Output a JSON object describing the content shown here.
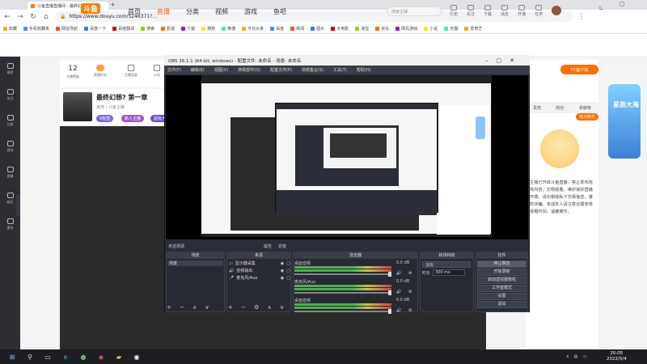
{
  "browser": {
    "tab_title": "斗鱼直播直播间 - 最终幻想?第一章",
    "url": "https://www.douyu.com/5246371?...",
    "bookmarks": [
      "收藏",
      "手机收藏夹",
      "网址导航",
      "百度一下",
      "百度翻译",
      "搜索",
      "影视",
      "下载",
      "搜狗",
      "微博",
      "今日头条",
      "百度",
      "新闻",
      "图片",
      "大电影",
      "淘宝",
      "京东",
      "网页游戏",
      "小说",
      "天猫",
      "爱奇艺"
    ]
  },
  "site": {
    "logo_text": "斗鱼",
    "nav": [
      "首页",
      "直播",
      "分类",
      "视频",
      "游戏",
      "鱼吧"
    ],
    "active_nav": 1,
    "search_placeholder": "搜索主播",
    "header_icons": [
      "历史",
      "关注",
      "下载",
      "消息",
      "开播",
      "任务"
    ],
    "sidebar": [
      "推荐",
      "关注",
      "分类",
      "游戏",
      "直播",
      "娱乐",
      "更多"
    ]
  },
  "room": {
    "followers": "12",
    "stat_labels": [
      "主播等级",
      "直播时长",
      "主播奖励",
      "公告",
      "贡献"
    ],
    "title": "最终幻想? 第一章",
    "subtitle": "其他 | 斗鱼主播",
    "tags": [
      "V标签",
      "新人主播",
      "超级大神"
    ],
    "pc_client": "PC客户端",
    "fan_club": "成为粉丝",
    "right_tabs": [
      "贵宾",
      "粉丝",
      "贡献榜"
    ],
    "promo_text": "星辰大海",
    "rules_text": "主播已开启斗鱼直播，禁止发布违规内容，文明观看，维护良好直播环境。请勿相信私下交易信息，谨防诈骗，未成年人请注意合理安排观看时间，适度娱乐。"
  },
  "obs": {
    "title": "OBS 26.1.1 (64-bit, windows) - 配置文件: 未命名 - 场景: 未命名",
    "menu": [
      "文件(F)",
      "编辑(E)",
      "视图(V)",
      "停靠部件(D)",
      "配置文件(P)",
      "场景集合(S)",
      "工具(T)",
      "帮助(H)"
    ],
    "scene_bar_label": "未选择源",
    "scene_bar_props": "属性",
    "scene_bar_filters": "滤镜",
    "docks": {
      "scenes": {
        "title": "场景",
        "items": [
          "场景"
        ]
      },
      "sources": {
        "title": "来源",
        "items": [
          "显示器采集",
          "音频输出",
          "麦克风/Aux"
        ]
      },
      "mixer": {
        "title": "混音器",
        "channels": [
          {
            "label": "桌面音频",
            "db": "0.0 dB"
          },
          {
            "label": "麦克风/Aux",
            "db": "0.0 dB"
          },
          {
            "label": "桌面音频",
            "db": "0.0 dB"
          }
        ]
      },
      "transitions": {
        "title": "转场特效",
        "type": "淡出",
        "duration_label": "时长",
        "duration_value": "300 ms"
      },
      "controls": {
        "title": "控件",
        "buttons": [
          "停止推流",
          "开始录制",
          "启动虚拟摄像机",
          "工作室模式",
          "设置",
          "退出"
        ]
      }
    }
  },
  "taskbar": {
    "time": "20:05",
    "date": "2022/5/4"
  }
}
